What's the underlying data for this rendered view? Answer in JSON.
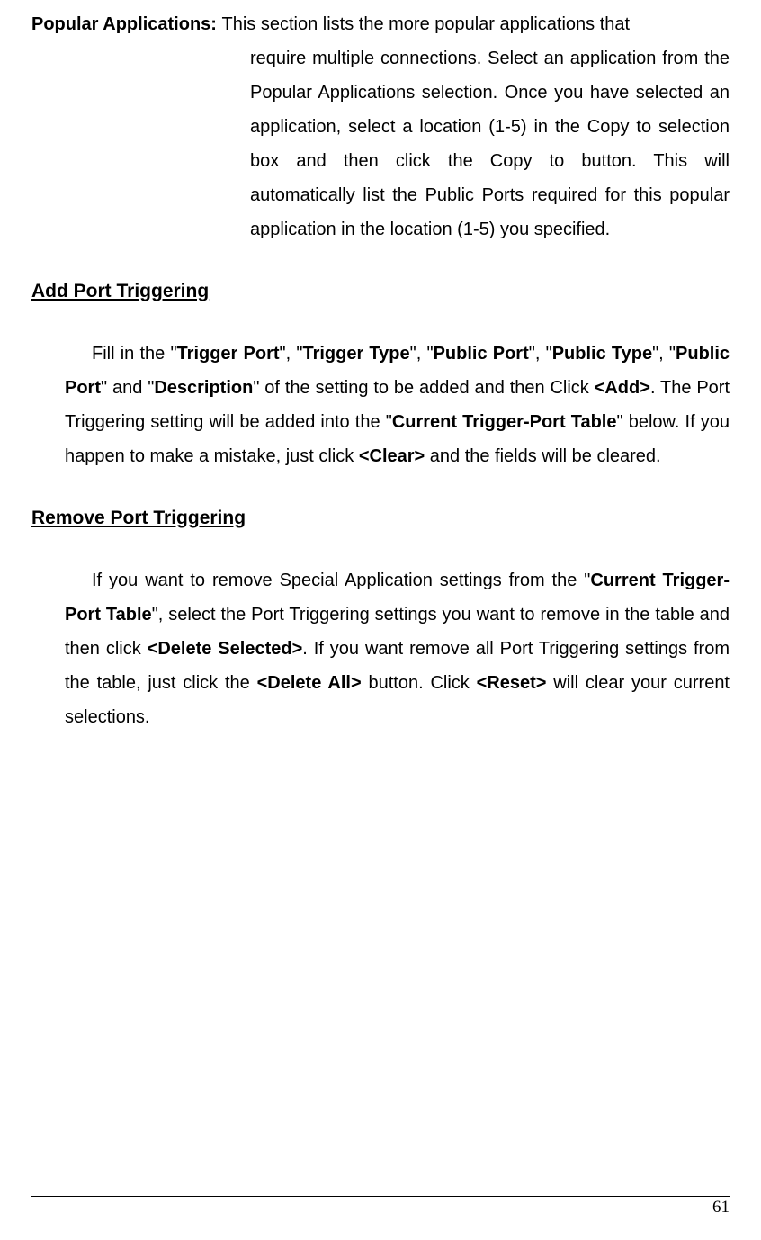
{
  "popularApps": {
    "label": "Popular Applications: ",
    "firstLine": "This section lists the more popular applications that",
    "rest": "require multiple connections. Select an application from the Popular Applications selection. Once you have selected an application, select a location (1-5) in the Copy to selection box and then click the Copy to button. This will automatically list the Public Ports required for this popular application in the location (1-5) you specified."
  },
  "addPort": {
    "heading": "Add Port Triggering",
    "p1_prefix": "Fill in the \"",
    "triggerPort": "Trigger Port",
    "p1_s1": "\", \"",
    "triggerType": "Trigger Type",
    "p1_s2": "\", \"",
    "publicPort1": "Public Port",
    "p1_s3": "\", \"",
    "publicType": "Public Type",
    "p1_s4": "\", \"",
    "publicPort2": "Public Port",
    "p1_s5": "\" and \"",
    "description": "Description",
    "p1_s6": "\" of the setting to be added and then Click ",
    "add": "<Add>",
    "p1_s7": ". The Port Triggering setting will be added into the \"",
    "currentTable": "Current Trigger-Port Table",
    "p1_s8": "\" below. If you happen to make a mistake, just click ",
    "clear": "<Clear>",
    "p1_s9": " and the fields will be cleared."
  },
  "removePort": {
    "heading": "Remove Port Triggering",
    "p1_prefix": "If you want to remove Special Application settings from the \"",
    "currentTable": "Current Trigger-Port Table",
    "p1_s1": "\", select the Port Triggering settings you want to remove in the table and then click ",
    "deleteSelected": "<Delete Selected>",
    "p1_s2": ". If you want remove all Port Triggering settings from the table, just click the ",
    "deleteAll": "<Delete All>",
    "p1_s3": " button. Click ",
    "reset": "<Reset>",
    "p1_s4": " will clear your current selections."
  },
  "pageNumber": "61"
}
